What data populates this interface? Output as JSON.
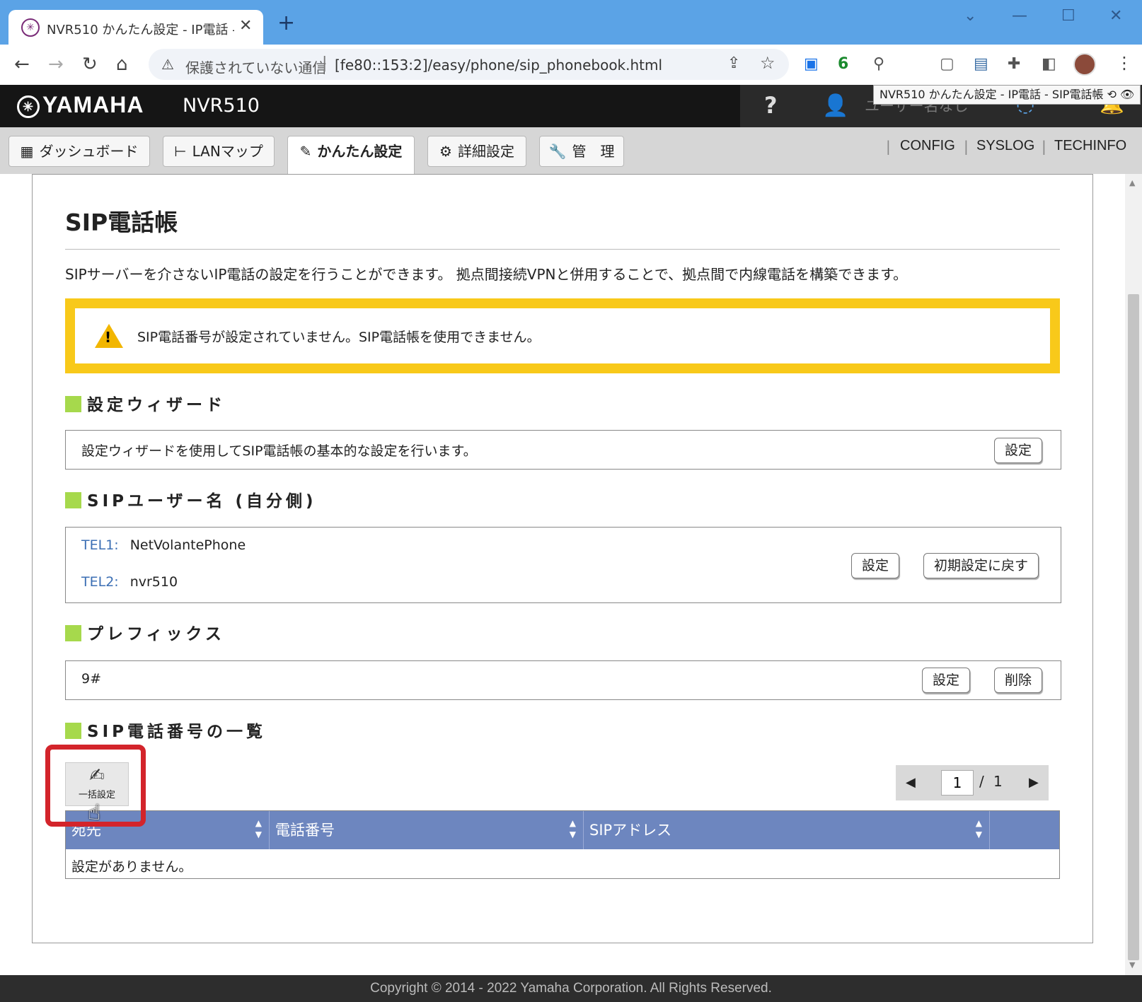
{
  "browser": {
    "tab_title": "NVR510 かんたん設定 - IP電話 - SIP電話帳",
    "tab_close": "✕",
    "new_tab": "+",
    "security_label": "保護されていない通信",
    "url": "[fe80::153:2]/easy/phone/sip_phonebook.html",
    "extension_badge": "6",
    "tooltip": "NVR510 かんたん設定 - IP電話 - SIP電話帳 ⟲ 👁"
  },
  "header": {
    "logo": "YAMAHA",
    "model": "NVR510",
    "help": "?",
    "user": "ユーザー名なし"
  },
  "menu": {
    "tabs": [
      {
        "label": "ダッシュボード",
        "icon": "grid-icon"
      },
      {
        "label": "LANマップ",
        "icon": "lanmap-icon"
      },
      {
        "label": "かんたん設定",
        "icon": "wand-icon"
      },
      {
        "label": "詳細設定",
        "icon": "gear-icon"
      },
      {
        "label": "管　理",
        "icon": "wrench-icon"
      }
    ],
    "active_tab": "かんたん設定",
    "links": [
      "CONFIG",
      "SYSLOG",
      "TECHINFO"
    ]
  },
  "page": {
    "title": "SIP電話帳",
    "description": "SIPサーバーを介さないIP電話の設定を行うことができます。 拠点間接続VPNと併用することで、拠点間で内線電話を構築できます。",
    "alert": "SIP電話番号が設定されていません。SIP電話帳を使用できません。"
  },
  "sections": {
    "wizard": {
      "heading": "設定ウィザード",
      "text": "設定ウィザードを使用してSIP電話帳の基本的な設定を行います。",
      "button": "設定"
    },
    "sip_user": {
      "heading": "SIPユーザー名 (自分側)",
      "tel1_label": "TEL1:",
      "tel1_value": "NetVolantePhone",
      "tel2_label": "TEL2:",
      "tel2_value": "nvr510",
      "set_button": "設定",
      "reset_button": "初期設定に戻す"
    },
    "prefix": {
      "heading": "プレフィックス",
      "value": "9#",
      "set_button": "設定",
      "delete_button": "削除"
    },
    "list": {
      "heading": "SIP電話番号の一覧",
      "bulk_button": "一括設定",
      "pager_current": "1",
      "pager_separator": "/",
      "pager_total": "1",
      "columns": [
        "宛先",
        "電話番号",
        "SIPアドレス",
        ""
      ],
      "empty_text": "設定がありません。"
    }
  },
  "footer": "Copyright © 2014 - 2022 Yamaha Corporation. All Rights Reserved.",
  "colors": {
    "accent_blue": "#5ba3e6",
    "alert_yellow": "#f8c91a",
    "section_green": "#a6d94c",
    "table_header": "#6d86bf",
    "highlight_red": "#d3242b"
  }
}
